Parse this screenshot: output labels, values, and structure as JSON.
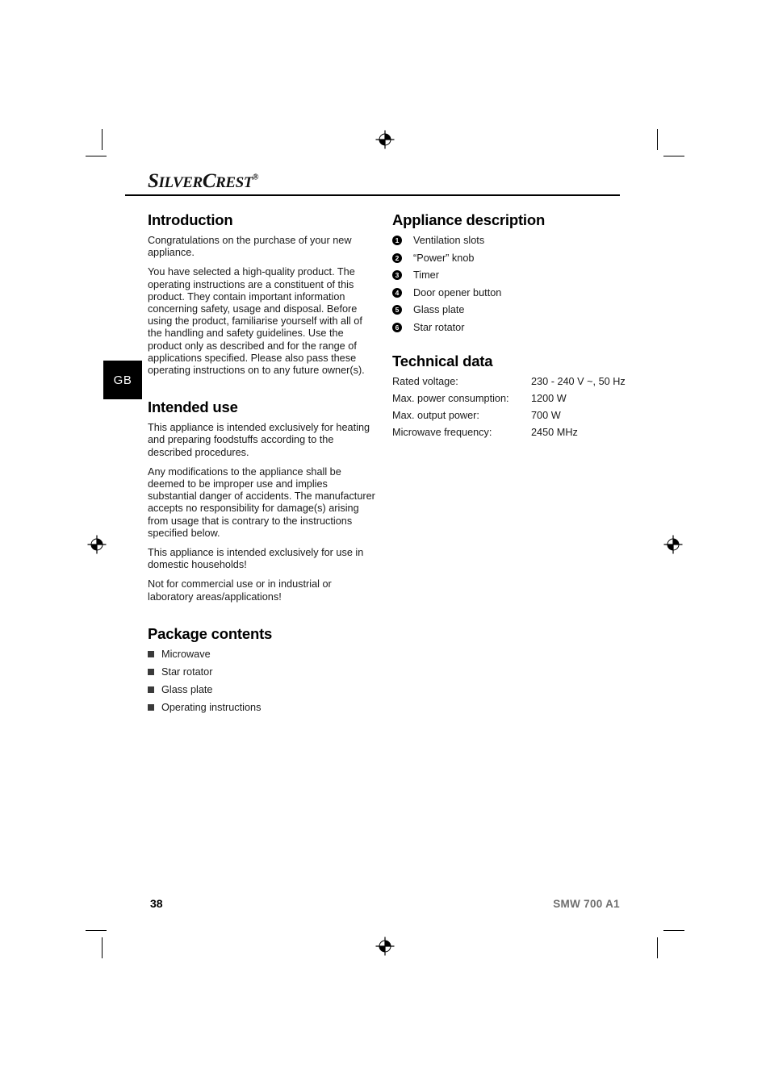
{
  "header": {
    "logo_part1": "S",
    "logo_part2": "ILVER",
    "logo_part3": "C",
    "logo_part4": "REST",
    "logo_registered": "®",
    "logo_text": "SILVERCREST®"
  },
  "language_tab": {
    "label": "GB"
  },
  "left_column": {
    "introduction": {
      "heading": "Introduction",
      "paragraphs": [
        "Congratulations on the purchase of your new appliance.",
        "You have selected a high-quality product. The operating instructions are a constituent of this product. They contain important information concerning safety, usage and disposal. Before using the product, familiarise yourself with all of the handling and safety guidelines. Use the product only as described and for the range of applications specified. Please also pass these operating instructions on to any future owner(s)."
      ]
    },
    "intended_use": {
      "heading": "Intended use",
      "paragraphs": [
        "This appliance is intended exclusively for heating and preparing foodstuffs according to the described procedures.",
        "Any modifications to the appliance shall be deemed to be improper use and implies substantial danger of accidents. The manufacturer accepts no responsibility for damage(s) arising from usage that is contrary to the instructions specified below.",
        "This appliance is intended exclusively for use in domestic households!",
        "Not for commercial use or in industrial or laboratory areas/applications!"
      ]
    },
    "package_contents": {
      "heading": "Package contents",
      "items": [
        "Microwave",
        "Star rotator",
        "Glass plate",
        "Operating instructions"
      ]
    }
  },
  "right_column": {
    "appliance_description": {
      "heading": "Appliance description",
      "items": [
        {
          "number": "1",
          "label": "Ventilation slots"
        },
        {
          "number": "2",
          "label": "“Power” knob"
        },
        {
          "number": "3",
          "label": "Timer"
        },
        {
          "number": "4",
          "label": "Door opener button"
        },
        {
          "number": "5",
          "label": "Glass plate"
        },
        {
          "number": "6",
          "label": "Star rotator"
        }
      ]
    },
    "technical_data": {
      "heading": "Technical data",
      "rows": [
        {
          "label": "Rated voltage:",
          "value": "230 - 240 V ~, 50 Hz"
        },
        {
          "label": "Max. power consumption:",
          "value": "1200 W"
        },
        {
          "label": "Max. output power:",
          "value": "700 W"
        },
        {
          "label": "Microwave frequency:",
          "value": "2450 MHz"
        }
      ]
    }
  },
  "footer": {
    "page_number": "38",
    "model": "SMW 700 A1"
  },
  "colors": {
    "text": "#1a1a1a",
    "heading": "#000000",
    "bullet": "#3a3a3a",
    "footer_model": "#6e6e6e",
    "tab_background": "#000000"
  }
}
